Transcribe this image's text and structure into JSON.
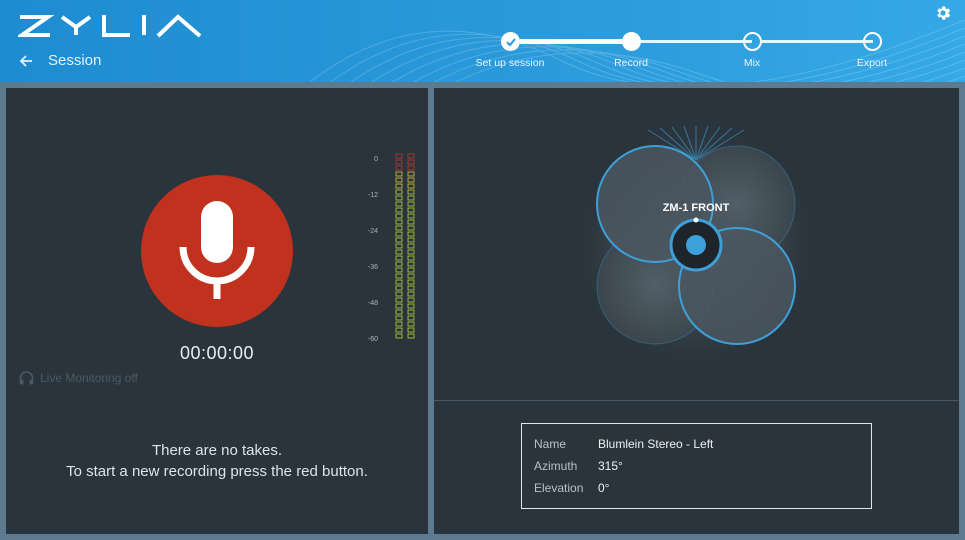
{
  "app": {
    "brand": "ZYLIA"
  },
  "header": {
    "back_label": "Session",
    "steps": [
      {
        "label": "Set up session",
        "state": "done"
      },
      {
        "label": "Record",
        "state": "current"
      },
      {
        "label": "Mix",
        "state": "pending"
      },
      {
        "label": "Export",
        "state": "pending"
      }
    ]
  },
  "recorder": {
    "timer": "00:00:00",
    "monitoring_label": "Live Monitoring off",
    "empty_line1": "There are no takes.",
    "empty_line2": "To start a new recording press the red button.",
    "meter_ticks": [
      "0",
      "-12",
      "-24",
      "-36",
      "-48",
      "-60"
    ]
  },
  "mic_view": {
    "label": "ZM-1 FRONT"
  },
  "info": {
    "name_key": "Name",
    "name_value": "Blumlein Stereo - Left",
    "azimuth_key": "Azimuth",
    "azimuth_value": "315°",
    "elevation_key": "Elevation",
    "elevation_value": "0°"
  },
  "colors": {
    "accent": "#2a9ada",
    "record": "#c0321e",
    "panel": "#2a343c",
    "polar": "#3ea0d8"
  },
  "icons": [
    "back-arrow-icon",
    "gear-icon",
    "check-icon",
    "microphone-icon",
    "headphones-icon"
  ]
}
